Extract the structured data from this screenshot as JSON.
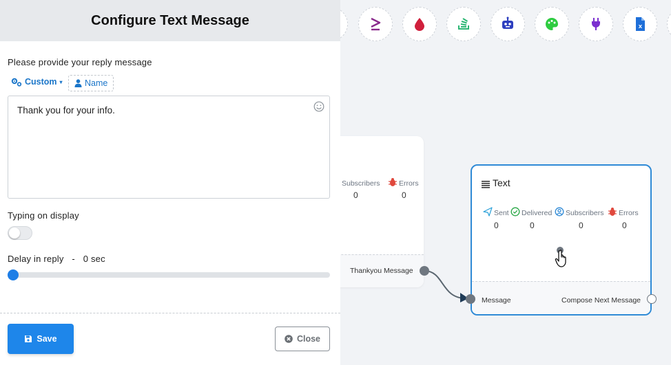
{
  "modal": {
    "title": "Configure Text Message",
    "reply_label": "Please provide your reply message",
    "custom_label": "Custom",
    "name_chip": "Name",
    "message_value": "Thank you for your info.",
    "typing_label": "Typing on display",
    "typing_on": false,
    "delay_label": "Delay in reply",
    "delay_sep": "-",
    "delay_value": "0 sec",
    "delay_fraction": 0,
    "save_label": "Save",
    "close_label": "Close"
  },
  "toolbar": {
    "icons": [
      "greater-equal-icon",
      "drop-icon",
      "stack-icon",
      "robot-icon",
      "palette-icon",
      "plug-icon",
      "excel-file-icon"
    ]
  },
  "node_left": {
    "stats": [
      {
        "label": "Subscribers",
        "value": "0"
      },
      {
        "label": "Errors",
        "value": "0"
      }
    ],
    "output_label": "Thankyou Message"
  },
  "node_text": {
    "title": "Text",
    "stats": [
      {
        "label": "Sent",
        "value": "0"
      },
      {
        "label": "Delivered",
        "value": "0"
      },
      {
        "label": "Subscribers",
        "value": "0"
      },
      {
        "label": "Errors",
        "value": "0"
      }
    ],
    "input_label": "Message",
    "output_label": "Compose Next Message"
  },
  "colors": {
    "accent": "#1e86ea",
    "node_border": "#2f8ad6",
    "error": "#e0483d",
    "sent": "#2aa0d8",
    "delivered": "#28a745"
  }
}
